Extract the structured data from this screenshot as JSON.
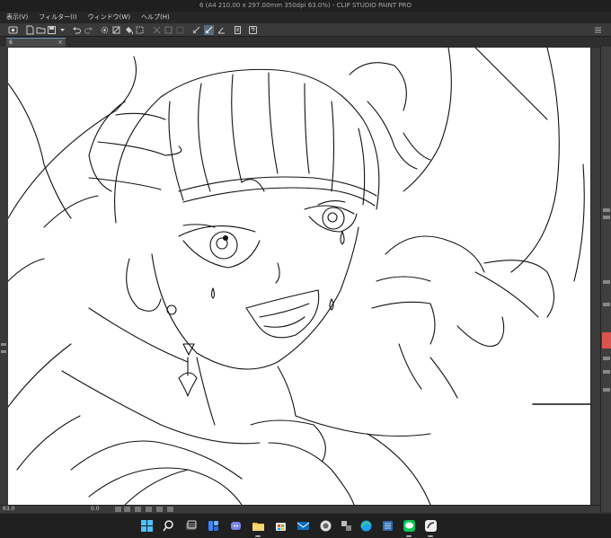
{
  "window": {
    "title": "6 (A4 210.00 x 297.00mm 350dpi 63.0%) - CLIP STUDIO PAINT PRO"
  },
  "menu": {
    "items": [
      "表示(V)",
      "フィルター(I)",
      "ウィンドウ(W)",
      "ヘルプ(H)"
    ]
  },
  "tab": {
    "label": "6",
    "close": "×"
  },
  "status": {
    "zoom": "63.0",
    "angle": "0.0"
  },
  "colors": {
    "accent": "#5a6b80",
    "red_swatch": "#d9534f",
    "canvas": "#ffffff"
  },
  "taskbar": {
    "icons": [
      "windows-start-icon",
      "search-icon",
      "task-view-icon",
      "widgets-icon",
      "teams-chat-icon",
      "file-explorer-icon",
      "store-icon",
      "mail-icon",
      "clip-studio-icon",
      "app-icon",
      "edge-browser-icon",
      "app-icon",
      "line-icon",
      "clip-studio-paint-icon"
    ]
  }
}
